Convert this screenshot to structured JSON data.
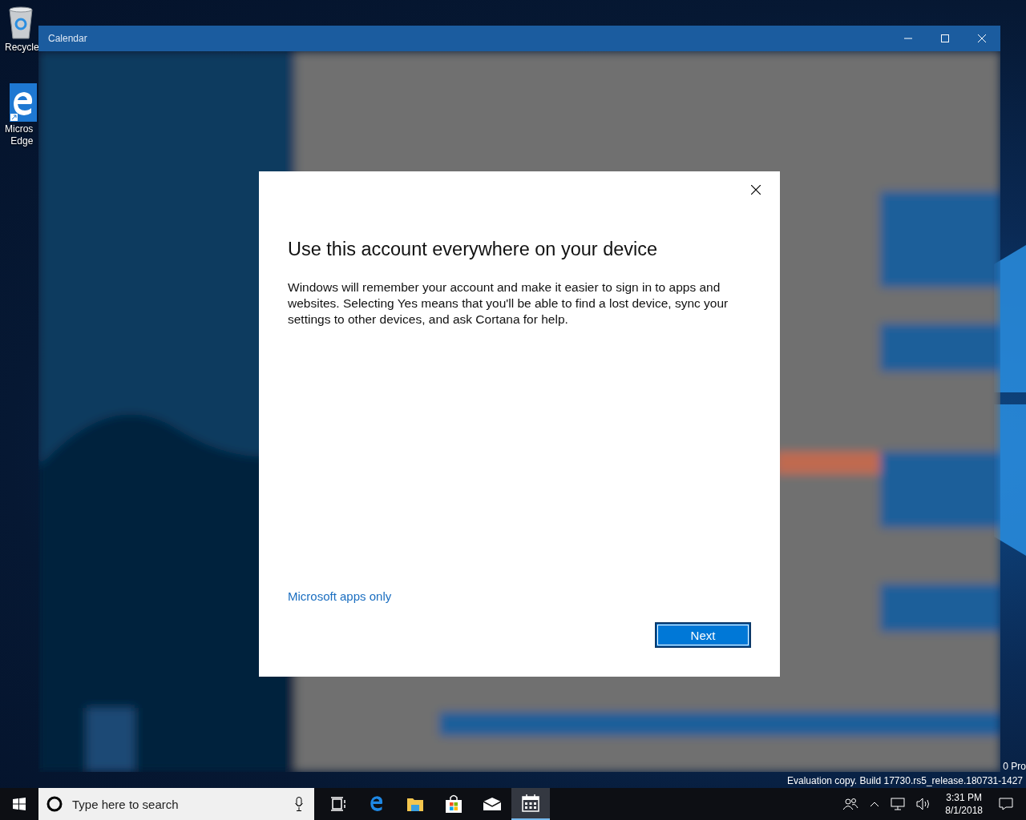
{
  "desktop": {
    "icons": [
      {
        "kind": "recycle",
        "lines": [
          "Recycle"
        ]
      },
      {
        "kind": "edge",
        "lines": [
          "Micros",
          "Edge"
        ]
      }
    ],
    "watermark": [
      "0 Pro",
      "Evaluation copy. Build 17730.rs5_release.180731-1427"
    ]
  },
  "window": {
    "title": "Calendar"
  },
  "dialog": {
    "title": "Use this account everywhere on your device",
    "body": "Windows will remember your account and make it easier to sign in to apps and websites. Selecting Yes means that you'll be able to find a lost device, sync your settings to other devices, and ask Cortana for help.",
    "link": "Microsoft apps only",
    "button": "Next"
  },
  "taskbar": {
    "search": {
      "placeholder": "Type here to search"
    },
    "apps": [
      {
        "kind": "taskview",
        "selected": false
      },
      {
        "kind": "edge",
        "selected": false
      },
      {
        "kind": "explorer",
        "selected": false
      },
      {
        "kind": "store",
        "selected": false
      },
      {
        "kind": "mail",
        "selected": false
      },
      {
        "kind": "calendar",
        "selected": true
      }
    ],
    "time": "3:31 PM",
    "date": "8/1/2018"
  }
}
